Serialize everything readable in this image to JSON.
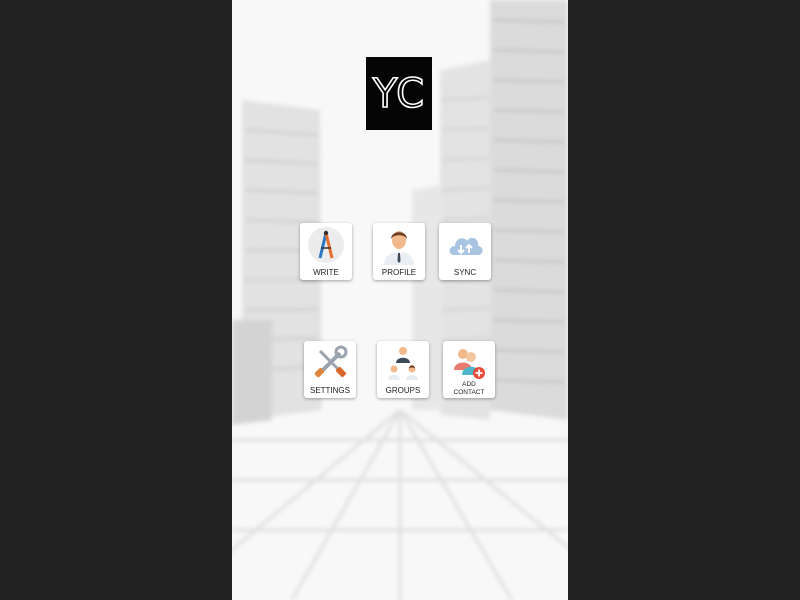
{
  "logo": {
    "text": "YC"
  },
  "tiles": {
    "write": {
      "label": "WRITE",
      "icon": "pen-compass-icon"
    },
    "profile": {
      "label": "PROFILE",
      "icon": "user-avatar-icon"
    },
    "sync": {
      "label": "SYNC",
      "icon": "cloud-sync-icon"
    },
    "settings": {
      "label": "SETTINGS",
      "icon": "tools-icon"
    },
    "groups": {
      "label": "GROUPS",
      "icon": "group-people-icon"
    },
    "add_contact": {
      "label_line1": "ADD",
      "label_line2": "CONTACT",
      "icon": "add-contact-icon"
    }
  },
  "colors": {
    "frame": "#222222",
    "background": "#f4f4f4",
    "tile": "#ffffff",
    "logo_bg": "#050505",
    "add_badge": "#e74c3c",
    "cloud": "#a9c4e0"
  }
}
